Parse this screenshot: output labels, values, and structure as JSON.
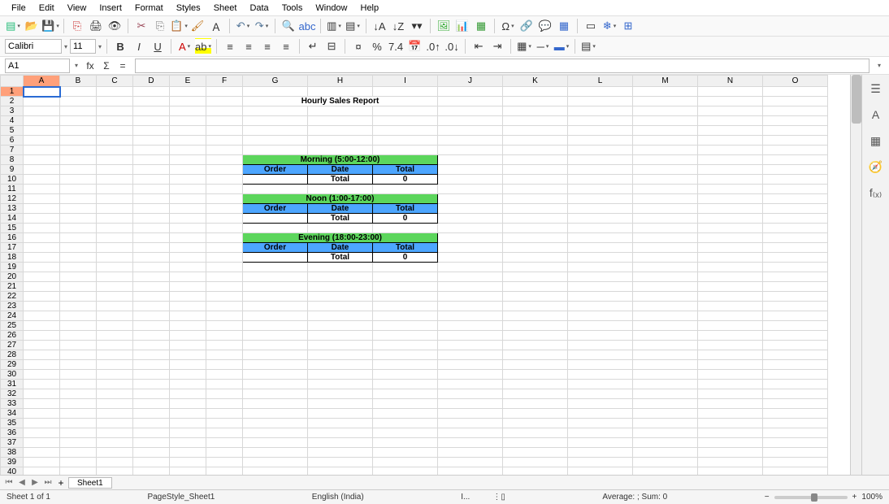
{
  "menu": [
    "File",
    "Edit",
    "View",
    "Insert",
    "Format",
    "Styles",
    "Sheet",
    "Data",
    "Tools",
    "Window",
    "Help"
  ],
  "font": {
    "name": "Calibri",
    "size": "11"
  },
  "namebox": "A1",
  "formula": "",
  "columns": [
    "A",
    "B",
    "C",
    "D",
    "E",
    "F",
    "G",
    "H",
    "I",
    "J",
    "K",
    "L",
    "M",
    "N",
    "O"
  ],
  "rows": 40,
  "selected": {
    "cell": "A1",
    "row": 1,
    "col": "A"
  },
  "report": {
    "title": "Hourly Sales Report",
    "sections": [
      {
        "head": "Morning (5:00-12:00)",
        "cols": [
          "Order",
          "Date",
          "Total"
        ],
        "total_label": "Total",
        "total_value": "0"
      },
      {
        "head": "Noon (1:00-17:00)",
        "cols": [
          "Order",
          "Date",
          "Total"
        ],
        "total_label": "Total",
        "total_value": "0"
      },
      {
        "head": "Evening (18:00-23:00)",
        "cols": [
          "Order",
          "Date",
          "Total"
        ],
        "total_label": "Total",
        "total_value": "0"
      }
    ]
  },
  "tabs": {
    "sheets": [
      "Sheet1"
    ],
    "active": "Sheet1"
  },
  "status": {
    "sheet": "Sheet 1 of 1",
    "pagestyle": "PageStyle_Sheet1",
    "lang": "English (India)",
    "insert_label": "I...",
    "selmode": "⋮▯",
    "summary": "Average: ; Sum: 0",
    "zoom": "100%"
  },
  "side_icons": [
    "properties-icon",
    "styles-icon",
    "gallery-icon",
    "navigator-icon",
    "functions-icon"
  ],
  "side_glyphs": [
    "☰",
    "A",
    "▦",
    "🧭",
    "f₍ₓ₎"
  ],
  "chart_data": [
    {
      "type": "table",
      "title": "Morning (5:00-12:00)",
      "columns": [
        "Order",
        "Date",
        "Total"
      ],
      "rows": [],
      "totals": {
        "Total": 0
      }
    },
    {
      "type": "table",
      "title": "Noon (1:00-17:00)",
      "columns": [
        "Order",
        "Date",
        "Total"
      ],
      "rows": [],
      "totals": {
        "Total": 0
      }
    },
    {
      "type": "table",
      "title": "Evening (18:00-23:00)",
      "columns": [
        "Order",
        "Date",
        "Total"
      ],
      "rows": [],
      "totals": {
        "Total": 0
      }
    }
  ]
}
